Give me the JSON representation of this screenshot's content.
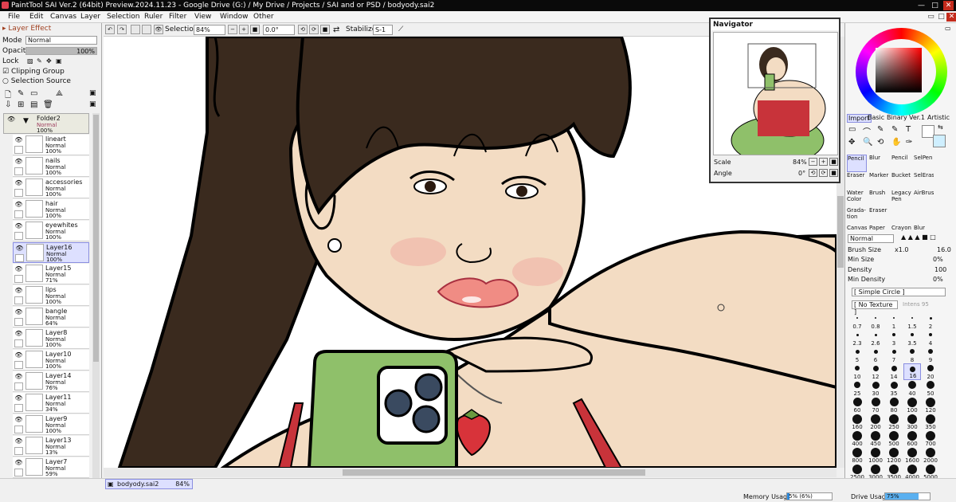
{
  "app": {
    "title": "PaintTool SAI Ver.2 (64bit) Preview.2024.11.23 - Google Drive (G:) / My Drive / Projects / SAI and or PSD / bodyody.sai2"
  },
  "menu": [
    "File",
    "Edit",
    "Canvas",
    "Layer",
    "Selection",
    "Ruler",
    "Filter",
    "View",
    "Window",
    "Other"
  ],
  "toolbar": {
    "selection_label": "Selection",
    "zoom": "84%",
    "angle": "0.0°",
    "stabilizer_label": "Stabilizer",
    "stabilizer_value": "S-1"
  },
  "layer_panel": {
    "effect_label": "Layer Effect",
    "mode_label": "Mode",
    "mode_value": "Normal",
    "opacity_label": "Opacity",
    "opacity_value": "100%",
    "opacity_fraction": 1.0,
    "lock_label": "Lock",
    "clipping_group_label": "Clipping Group",
    "selection_source_label": "Selection Source",
    "folder": {
      "name": "Folder2",
      "mode": "Normal",
      "opacity": "100%"
    },
    "layers": [
      {
        "name": "lineart",
        "mode": "Normal",
        "opacity": "100%"
      },
      {
        "name": "nails",
        "mode": "Normal",
        "opacity": "100%"
      },
      {
        "name": "accessories",
        "mode": "Normal",
        "opacity": "100%"
      },
      {
        "name": "hair",
        "mode": "Normal",
        "opacity": "100%"
      },
      {
        "name": "eyewhites",
        "mode": "Normal",
        "opacity": "100%"
      },
      {
        "name": "Layer16",
        "mode": "Normal",
        "opacity": "100%"
      },
      {
        "name": "Layer15",
        "mode": "Normal",
        "opacity": "71%"
      },
      {
        "name": "lips",
        "mode": "Normal",
        "opacity": "100%"
      },
      {
        "name": "bangle",
        "mode": "Normal",
        "opacity": "64%"
      },
      {
        "name": "Layer8",
        "mode": "Normal",
        "opacity": "100%"
      },
      {
        "name": "Layer10",
        "mode": "Normal",
        "opacity": "100%"
      },
      {
        "name": "Layer14",
        "mode": "Normal",
        "opacity": "76%"
      },
      {
        "name": "Layer11",
        "mode": "Normal",
        "opacity": "34%"
      },
      {
        "name": "Layer9",
        "mode": "Normal",
        "opacity": "100%"
      },
      {
        "name": "Layer13",
        "mode": "Normal",
        "opacity": "13%"
      },
      {
        "name": "Layer7",
        "mode": "Normal",
        "opacity": "59%"
      }
    ]
  },
  "navigator": {
    "title": "Navigator",
    "scale_label": "Scale",
    "scale_value": "84%",
    "angle_label": "Angle",
    "angle_value": "0°"
  },
  "right_panel": {
    "tabs": [
      "Import",
      "Basic",
      "Binary",
      "Ver.1",
      "Artistic"
    ],
    "tools": [
      [
        "Pencil",
        "Blur",
        "Pencil",
        "SelPen"
      ],
      [
        "Eraser",
        "Marker",
        "Bucket",
        "SelEras"
      ],
      [
        "Water Color",
        "Brush",
        "Legacy Pen",
        "AirBrush"
      ],
      [
        "Grada-tion",
        "Eraser",
        "",
        ""
      ],
      [
        "Canvas",
        "Paper",
        "Crayon",
        "Blur"
      ]
    ],
    "blend_mode": "Normal",
    "brush_size_label": "Brush Size",
    "brush_size_multiplier": "x1.0",
    "brush_size_value": "16.0",
    "min_size_label": "Min Size",
    "min_size_value": "0%",
    "density_label": "Density",
    "density_value": "100",
    "min_density_label": "Min Density",
    "min_density_value": "0%",
    "shape": "[ Simple Circle ]",
    "texture": "[ No Texture ]",
    "texture_strength": "Intens 95",
    "brush_sizes": [
      "0.7",
      "0.8",
      "1",
      "1.5",
      "2",
      "2.3",
      "2.6",
      "3",
      "3.5",
      "4",
      "5",
      "6",
      "7",
      "8",
      "9",
      "10",
      "12",
      "14",
      "16",
      "20",
      "25",
      "30",
      "35",
      "40",
      "50",
      "60",
      "70",
      "80",
      "100",
      "120",
      "160",
      "200",
      "250",
      "300",
      "350",
      "400",
      "450",
      "500",
      "600",
      "700",
      "800",
      "1000",
      "1200",
      "1600",
      "2000",
      "2500",
      "3000",
      "3500",
      "4000",
      "5000"
    ],
    "selected_brush_size": "16"
  },
  "status": {
    "doc_tab": "bodyody.sai2",
    "doc_zoom": "84%",
    "memory_label": "Memory Usage",
    "memory_value": "5% (6%)",
    "memory_fraction": 0.05,
    "drive_label": "Drive Usage",
    "drive_value": "75%",
    "drive_fraction": 0.75
  },
  "colors": {
    "title_bg": "#0a0a0a",
    "hair": "#3a2a1e",
    "skin": "#f3dcc3",
    "lips": "#f08c84",
    "phone_case": "#8fc06a",
    "strawberry": "#d8333a",
    "top_red": "#c8333a",
    "selection_highlight": "#dde0ff",
    "layer_clip_mark": "#d04060"
  }
}
